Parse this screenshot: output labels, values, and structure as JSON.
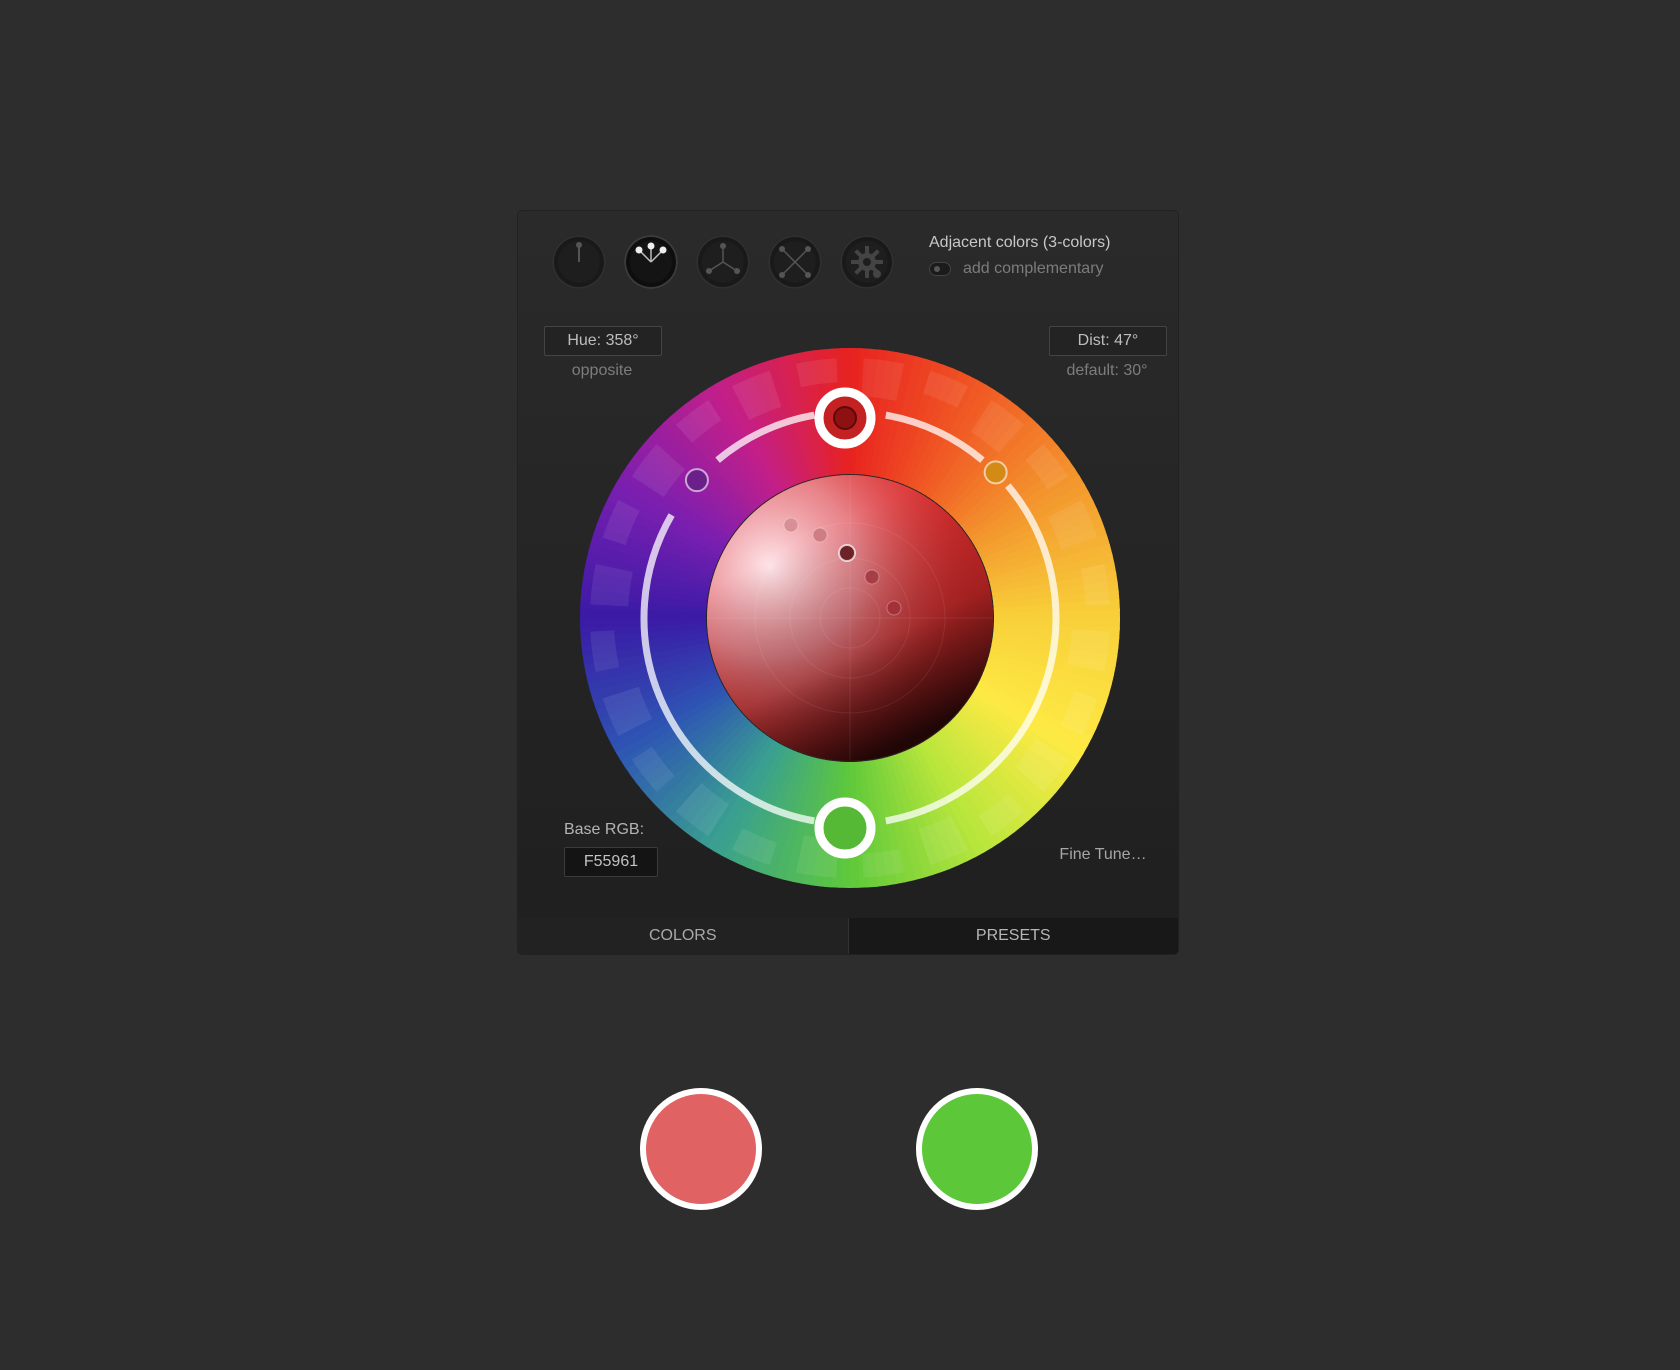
{
  "header": {
    "mode_title": "Adjacent colors (3-colors)",
    "complementary_label": "add complementary"
  },
  "modes": [
    {
      "name": "single-hue-icon",
      "active": false
    },
    {
      "name": "adjacent-colors-icon",
      "active": true
    },
    {
      "name": "triad-icon",
      "active": false
    },
    {
      "name": "tetrad-icon",
      "active": false
    },
    {
      "name": "custom-gear-icon",
      "active": false
    }
  ],
  "hue": {
    "value": "Hue: 358°",
    "sublabel": "opposite"
  },
  "dist": {
    "value": "Dist: 47°",
    "sublabel": "default: 30°"
  },
  "base": {
    "label": "Base RGB:",
    "value": "F55961"
  },
  "fine_tune": "Fine Tune…",
  "tabs": {
    "colors": "COLORS",
    "presets": "PRESETS"
  },
  "colors": {
    "primary": "#e06262",
    "complement": "#5dc73a"
  },
  "wheel": {
    "base_hue_deg": 358
  }
}
